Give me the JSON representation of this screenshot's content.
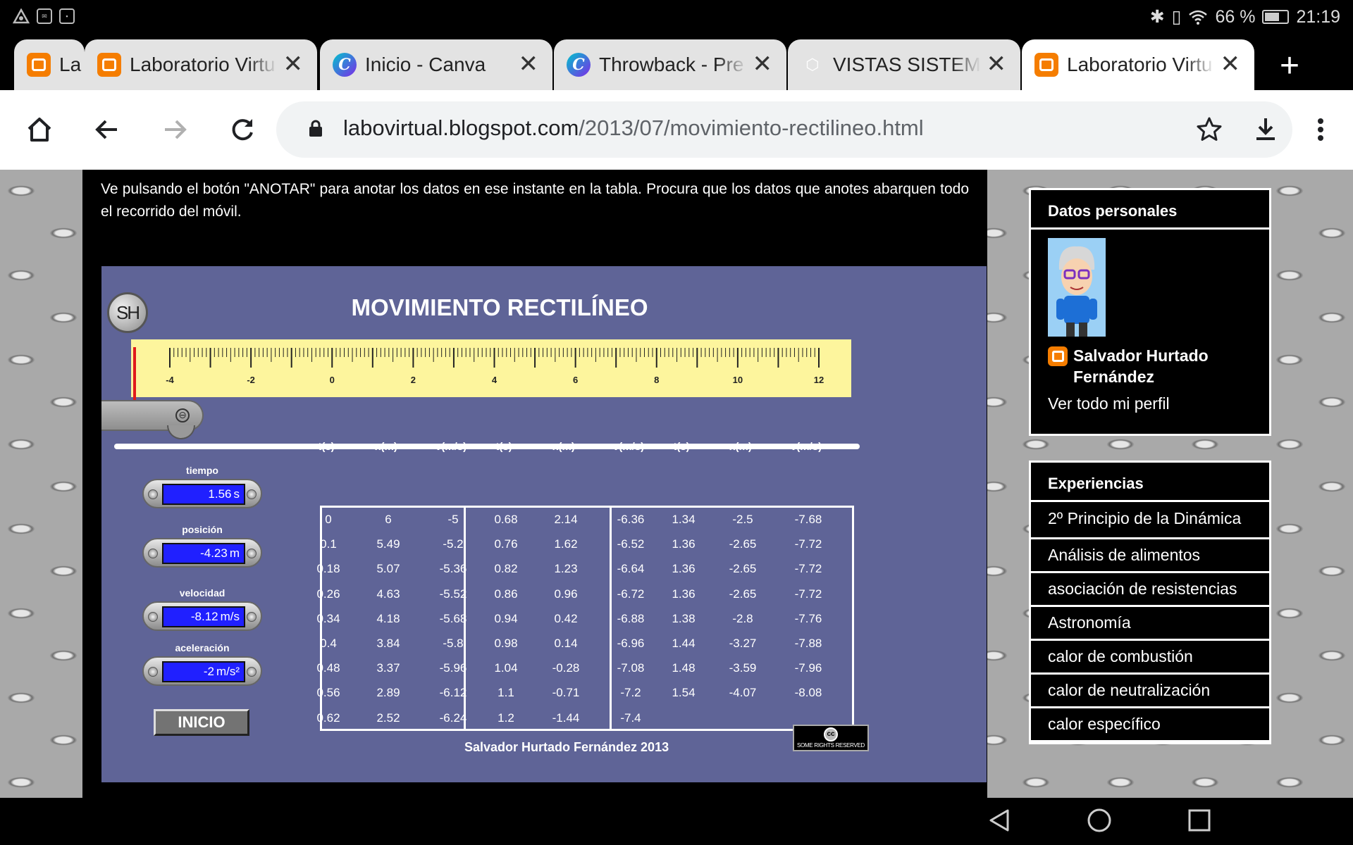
{
  "status_bar": {
    "battery": "66 %",
    "battery_level": 0.66,
    "time": "21:19"
  },
  "tabs": [
    {
      "title": "La",
      "icon": "blogger-icon",
      "active": false
    },
    {
      "title": "Laboratorio Virtu",
      "icon": "blogger-icon",
      "active": false
    },
    {
      "title": "Inicio - Canva",
      "icon": "canva-icon",
      "active": false
    },
    {
      "title": "Throwback - Pre",
      "icon": "canva-icon",
      "active": false
    },
    {
      "title": "VISTAS SISTEMA",
      "icon": "vistas-icon",
      "active": false
    },
    {
      "title": "Laboratorio Virtu",
      "icon": "blogger-icon",
      "active": true
    }
  ],
  "toolbar": {
    "url_host": "labovirtual.blogspot.com",
    "url_path": "/2013/07/movimiento-rectilineo.html"
  },
  "post": {
    "intro": "Ve pulsando el botón \"ANOTAR\" para anotar los datos en ese instante en la tabla. Procura que los datos que anotes abarquen todo el recorrido del móvil."
  },
  "simulation": {
    "logo": "SH",
    "title": "MOVIMIENTO RECTILÍNEO",
    "ruler_labels": [
      "-4",
      "-2",
      "0",
      "2",
      "4",
      "6",
      "8",
      "10",
      "12"
    ],
    "readouts": [
      {
        "label": "tiempo",
        "value": "1.56",
        "unit": "s"
      },
      {
        "label": "posición",
        "value": "-4.23",
        "unit": "m"
      },
      {
        "label": "velocidad",
        "value": "-8.12",
        "unit": "m/s"
      },
      {
        "label": "aceleración",
        "value": "-2",
        "unit": "m/s²"
      }
    ],
    "button": "INICIO",
    "table_headers": [
      "t(s)",
      "x(m)",
      "v(m/s)",
      "t(s)",
      "x(m)",
      "v(m/s)",
      "t(s)",
      "x(m)",
      "v(m/s)"
    ],
    "table_blocks": [
      [
        [
          "0",
          "6",
          "-5"
        ],
        [
          "0.1",
          "5.49",
          "-5.2"
        ],
        [
          "0.18",
          "5.07",
          "-5.36"
        ],
        [
          "0.26",
          "4.63",
          "-5.52"
        ],
        [
          "0.34",
          "4.18",
          "-5.68"
        ],
        [
          "0.4",
          "3.84",
          "-5.8"
        ],
        [
          "0.48",
          "3.37",
          "-5.96"
        ],
        [
          "0.56",
          "2.89",
          "-6.12"
        ],
        [
          "0.62",
          "2.52",
          "-6.24"
        ]
      ],
      [
        [
          "0.68",
          "2.14",
          "-6.36"
        ],
        [
          "0.76",
          "1.62",
          "-6.52"
        ],
        [
          "0.82",
          "1.23",
          "-6.64"
        ],
        [
          "0.86",
          "0.96",
          "-6.72"
        ],
        [
          "0.94",
          "0.42",
          "-6.88"
        ],
        [
          "0.98",
          "0.14",
          "-6.96"
        ],
        [
          "1.04",
          "-0.28",
          "-7.08"
        ],
        [
          "1.1",
          "-0.71",
          "-7.2"
        ],
        [
          "1.2",
          "-1.44",
          "-7.4"
        ]
      ],
      [
        [
          "1.34",
          "-2.5",
          "-7.68"
        ],
        [
          "1.36",
          "-2.65",
          "-7.72"
        ],
        [
          "1.36",
          "-2.65",
          "-7.72"
        ],
        [
          "1.36",
          "-2.65",
          "-7.72"
        ],
        [
          "1.38",
          "-2.8",
          "-7.76"
        ],
        [
          "1.44",
          "-3.27",
          "-7.88"
        ],
        [
          "1.48",
          "-3.59",
          "-7.96"
        ],
        [
          "1.54",
          "-4.07",
          "-8.08"
        ]
      ]
    ],
    "copyright": "Salvador Hurtado Fernández 2013",
    "cc_text": "SOME RIGHTS RESERVED"
  },
  "sidebar": {
    "profile": {
      "title": "Datos personales",
      "name": "Salvador Hurtado Fernández",
      "link": "Ver todo mi perfil"
    },
    "experiences": {
      "title": "Experiencias",
      "items": [
        "2º Principio de la Dinámica",
        "Análisis de alimentos",
        "asociación de resistencias",
        "Astronomía",
        "calor de combustión",
        "calor de neutralización",
        "calor específico"
      ]
    }
  },
  "colors": {
    "sim_background": "#5f6497",
    "ruler": "#fdf59d",
    "lcd": "#2020ff",
    "blogger": "#f57d00"
  }
}
